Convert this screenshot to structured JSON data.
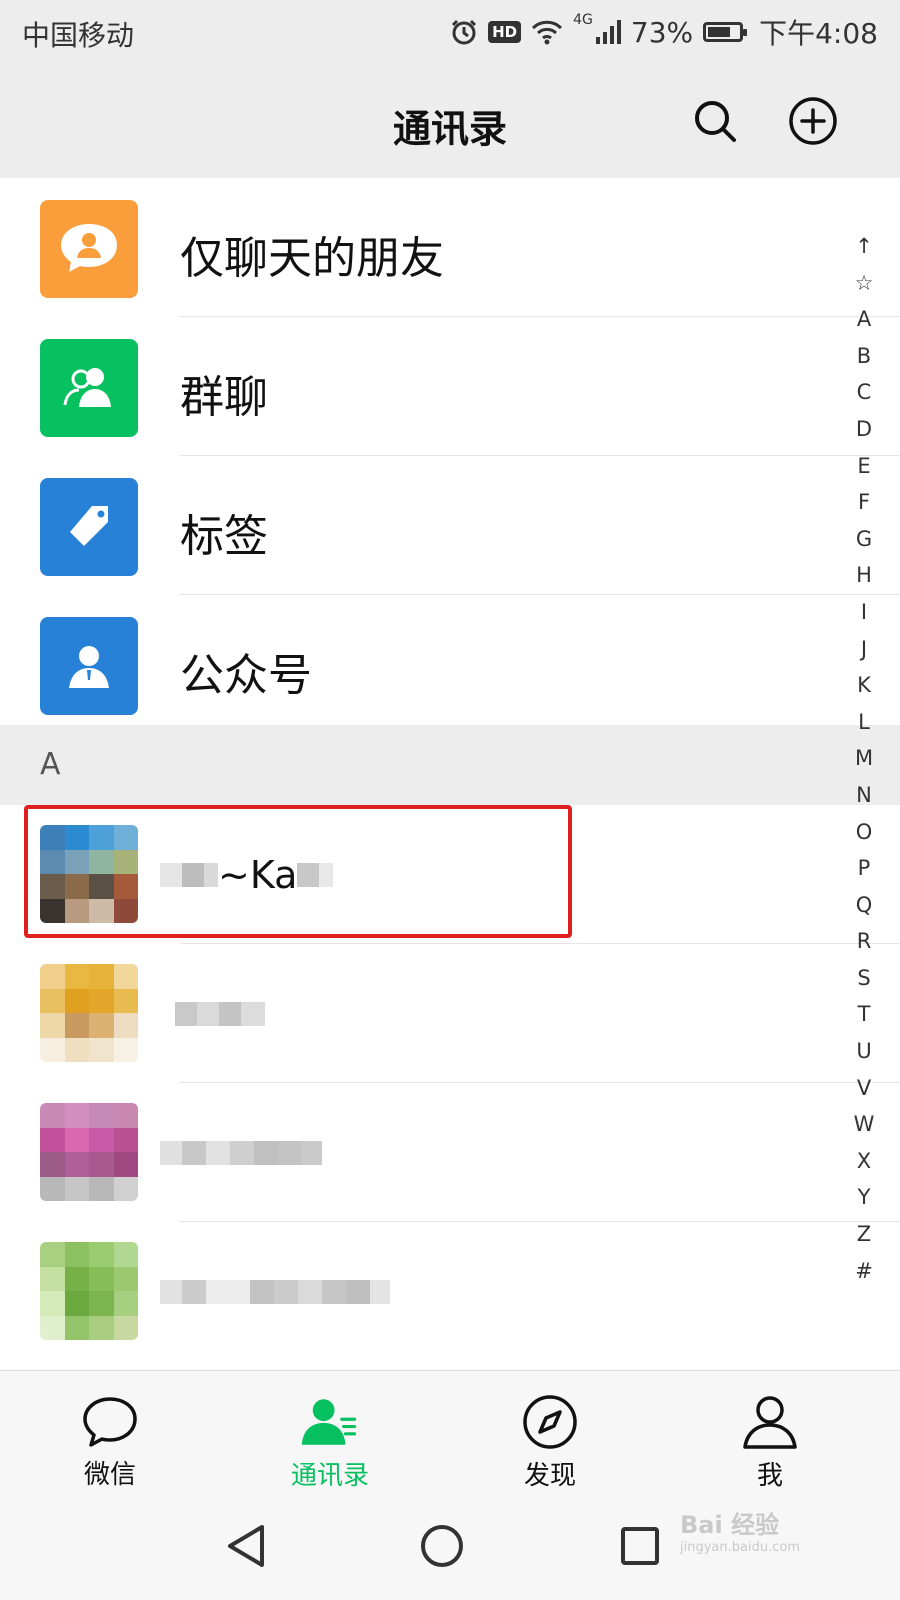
{
  "status_bar": {
    "carrier": "中国移动",
    "network": "4G",
    "hd": "HD",
    "battery_percent": "73%",
    "battery_level": 0.73,
    "time": "下午4:08"
  },
  "header": {
    "title": "通讯录",
    "search_icon": "search-icon",
    "add_icon": "plus-circle-icon"
  },
  "menu": {
    "items": [
      {
        "label": "仅聊天的朋友",
        "icon": "chat-person-icon",
        "color": "#fa9d3b"
      },
      {
        "label": "群聊",
        "icon": "group-icon",
        "color": "#07c160"
      },
      {
        "label": "标签",
        "icon": "tag-icon",
        "color": "#2782d7"
      },
      {
        "label": "公众号",
        "icon": "official-account-icon",
        "color": "#2782d7"
      }
    ]
  },
  "contacts": {
    "section_letter": "A",
    "first_name": "~Ka"
  },
  "index_bar": [
    "↑",
    "☆",
    "A",
    "B",
    "C",
    "D",
    "E",
    "F",
    "G",
    "H",
    "I",
    "J",
    "K",
    "L",
    "M",
    "N",
    "O",
    "P",
    "Q",
    "R",
    "S",
    "T",
    "U",
    "V",
    "W",
    "X",
    "Y",
    "Z",
    "#"
  ],
  "tabs": [
    {
      "label": "微信",
      "icon": "chat-bubble-icon"
    },
    {
      "label": "通讯录",
      "icon": "contacts-icon"
    },
    {
      "label": "发现",
      "icon": "compass-icon"
    },
    {
      "label": "我",
      "icon": "person-icon"
    }
  ],
  "colors": {
    "accent": "#07c160",
    "highlight": "#e02020"
  },
  "watermark": {
    "main": "Bai 经验",
    "sub": "jingyan.baidu.com"
  }
}
